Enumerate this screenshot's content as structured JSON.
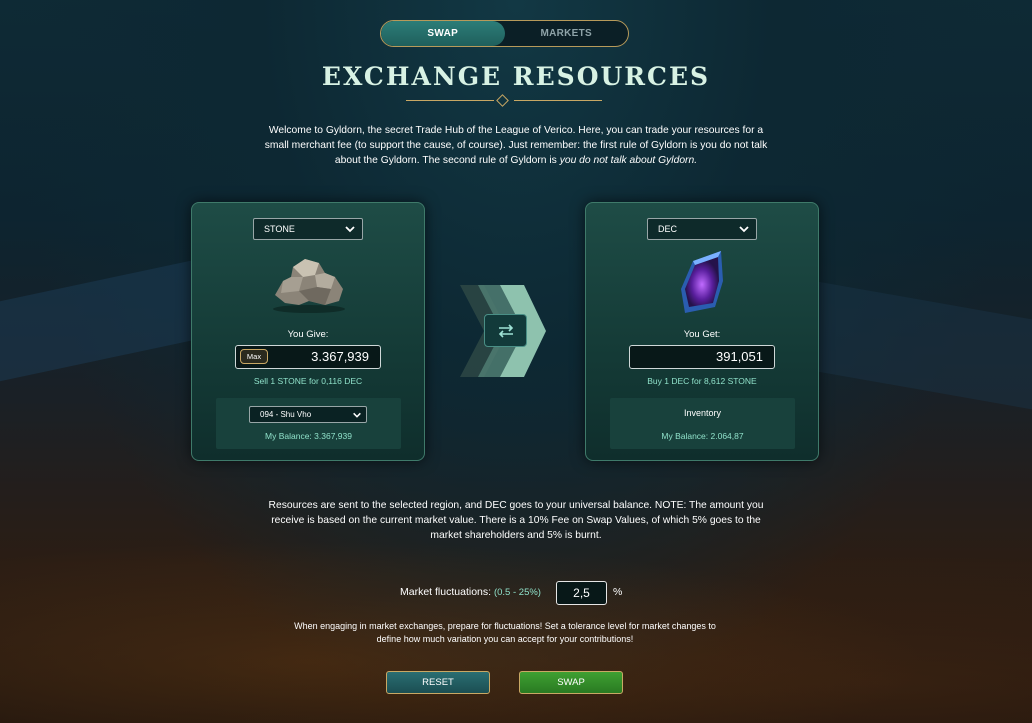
{
  "tabs": [
    {
      "label": "SWAP",
      "active": true
    },
    {
      "label": "MARKETS",
      "active": false
    }
  ],
  "title": "EXCHANGE RESOURCES",
  "intro": {
    "text": "Welcome to Gyldorn, the secret Trade Hub of the League of Verico. Here, you can trade your resources for a small merchant fee (to support the cause, of course). Just remember: the first rule of Gyldorn is you do not talk about the Gyldorn. The second rule of Gyldorn is ",
    "emphasis": "you do not talk about Gyldorn."
  },
  "give": {
    "resource": "STONE",
    "label": "You Give:",
    "max_label": "Max",
    "amount": "3.367,939",
    "rate": "Sell 1 STONE for 0,116 DEC",
    "region": "094 - Shu Vho",
    "balance": "My Balance: 3.367,939",
    "icon": "stone-icon"
  },
  "get": {
    "resource": "DEC",
    "label": "You Get:",
    "amount": "391,051",
    "rate": "Buy 1 DEC for 8,612 STONE",
    "inventory_label": "Inventory",
    "balance": "My Balance: 2.064,87",
    "icon": "dec-crystal-icon"
  },
  "note": "Resources are sent to the selected region, and DEC goes to your universal balance. NOTE: The amount you receive is based on the current market value. There is a 10% Fee on Swap Values, of which 5% goes to the market shareholders and 5% is burnt.",
  "fluctuation": {
    "label": "Market fluctuations:",
    "range": "(0.5 - 25%)",
    "value": "2,5",
    "unit": "%",
    "note": "When engaging in market exchanges, prepare for fluctuations! Set a tolerance level for market changes to define how much variation you can accept for your contributions!"
  },
  "buttons": {
    "reset": "RESET",
    "swap": "SWAP"
  },
  "colors": {
    "accent_gold": "#c9a864",
    "teal": "#8fe0c9",
    "swap_green": "#3fa032"
  }
}
